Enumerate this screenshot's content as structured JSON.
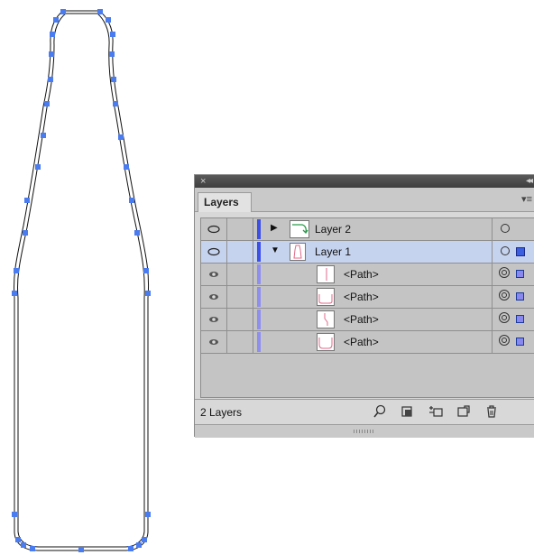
{
  "panel": {
    "close_glyph": "×",
    "collapse_glyph": "◂◂",
    "tab_label": "Layers",
    "menu_glyph": "▾≡",
    "footer_label": "2 Layers",
    "colors": {
      "layer2": "#3c4fe8",
      "layer1": "#3c4fe8",
      "path": "#8e8ef0",
      "selected_row": "#c6d3ef",
      "anchor": "#4a7cf0"
    }
  },
  "layers": [
    {
      "name": "Layer 2",
      "expanded": false,
      "level": 0
    },
    {
      "name": "Layer 1",
      "expanded": true,
      "level": 0,
      "selected": true
    },
    {
      "name": "<Path>",
      "level": 1
    },
    {
      "name": "<Path>",
      "level": 1
    },
    {
      "name": "<Path>",
      "level": 1
    },
    {
      "name": "<Path>",
      "level": 1
    }
  ],
  "footer_icons": [
    "locate-object-icon",
    "make-clipping-mask-icon",
    "create-sublayer-icon",
    "create-new-layer-icon",
    "delete-icon"
  ]
}
